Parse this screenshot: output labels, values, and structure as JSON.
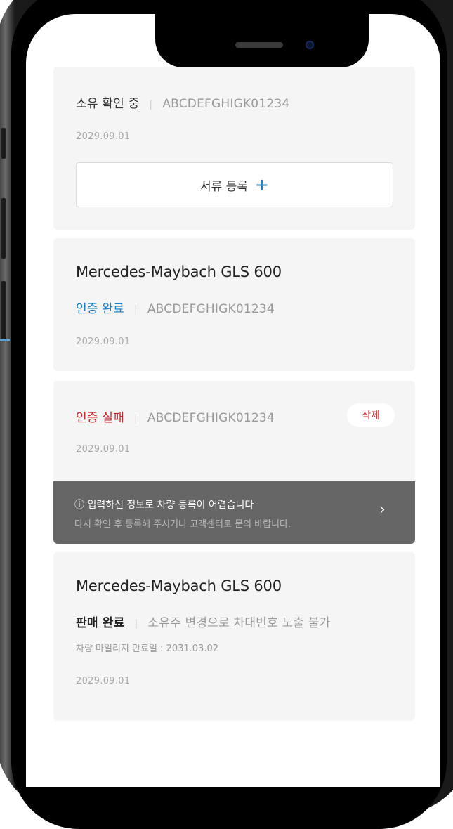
{
  "cards": [
    {
      "status": "소유 확인 중",
      "code": "ABCDEFGHIGK01234",
      "date": "2029.09.01",
      "doc_button": "서류 등록",
      "doc_button_icon": "plus-icon"
    },
    {
      "title": "Mercedes-Maybach GLS 600",
      "status": "인증 완료",
      "code": "ABCDEFGHIGK01234",
      "date": "2029.09.01"
    },
    {
      "status": "인증 실패",
      "code": "ABCDEFGHIGK01234",
      "date": "2029.09.01",
      "delete_button": "삭제",
      "error": {
        "icon": "ⓘ",
        "message": "입력하신 정보로 차량 등록이 어렵습니다",
        "sub_message": "다시 확인 후 등록해 주시거나 고객센터로 문의 바랍니다.",
        "chevron": "›"
      }
    },
    {
      "title": "Mercedes-Maybach GLS 600",
      "status": "판매 완료",
      "note": "소유주 변경으로 차대번호 노출 불가",
      "mileage": "차량 마일리지 만료일 : 2031.03.02",
      "date": "2029.09.01"
    }
  ],
  "colors": {
    "accent_blue": "#1a7fc4",
    "error_red": "#c8262b",
    "card_bg": "#f5f5f5",
    "error_bar_bg": "#666666"
  }
}
